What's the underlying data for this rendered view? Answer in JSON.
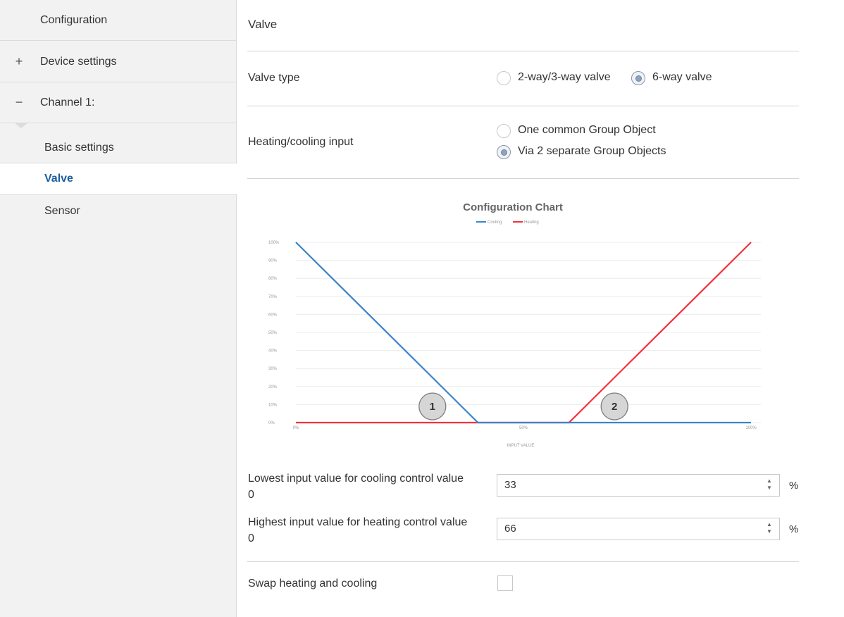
{
  "sidebar": {
    "configuration": "Configuration",
    "device_settings": "Device settings",
    "device_settings_sign": "+",
    "channel": "Channel 1:",
    "channel_sign": "−",
    "basic_settings": "Basic settings",
    "valve": "Valve",
    "sensor": "Sensor"
  },
  "main": {
    "title": "Valve",
    "valve_type": {
      "label": "Valve type",
      "options": [
        "2-way/3-way valve",
        "6-way valve"
      ],
      "selected": "6-way valve"
    },
    "heating_cooling_input": {
      "label": "Heating/cooling input",
      "options": [
        "One common Group Object",
        "Via 2 separate Group Objects"
      ],
      "selected": "Via 2 separate Group Objects"
    },
    "lowest_input": {
      "label_line1": "Lowest input value for cooling control value",
      "label_line2": "0",
      "value": "33",
      "unit": "%"
    },
    "highest_input": {
      "label_line1": "Highest input value for heating control value",
      "label_line2": "0",
      "value": "66",
      "unit": "%"
    },
    "swap": {
      "label": "Swap heating and cooling",
      "checked": false
    }
  },
  "chart_data": {
    "type": "line",
    "title": "Configuration Chart",
    "xlabel": "INPUT VALUE",
    "ylabel": "",
    "x_ticks": [
      "0%",
      "50%",
      "100%"
    ],
    "y_ticks": [
      "0%",
      "10%",
      "20%",
      "30%",
      "40%",
      "50%",
      "60%",
      "70%",
      "80%",
      "90%",
      "100%"
    ],
    "xlim": [
      0,
      100
    ],
    "ylim": [
      0,
      100
    ],
    "grid": true,
    "legend_position": "top-center",
    "series": [
      {
        "name": "Cooling",
        "color": "#3a84c9",
        "x": [
          0,
          40,
          100
        ],
        "y": [
          100,
          0,
          0
        ]
      },
      {
        "name": "Heating",
        "color": "#f2323c",
        "x": [
          0,
          60,
          100
        ],
        "y": [
          0,
          0,
          100
        ]
      }
    ],
    "markers": [
      {
        "label": "1",
        "x": 30,
        "y": 0
      },
      {
        "label": "2",
        "x": 70,
        "y": 0
      }
    ]
  }
}
